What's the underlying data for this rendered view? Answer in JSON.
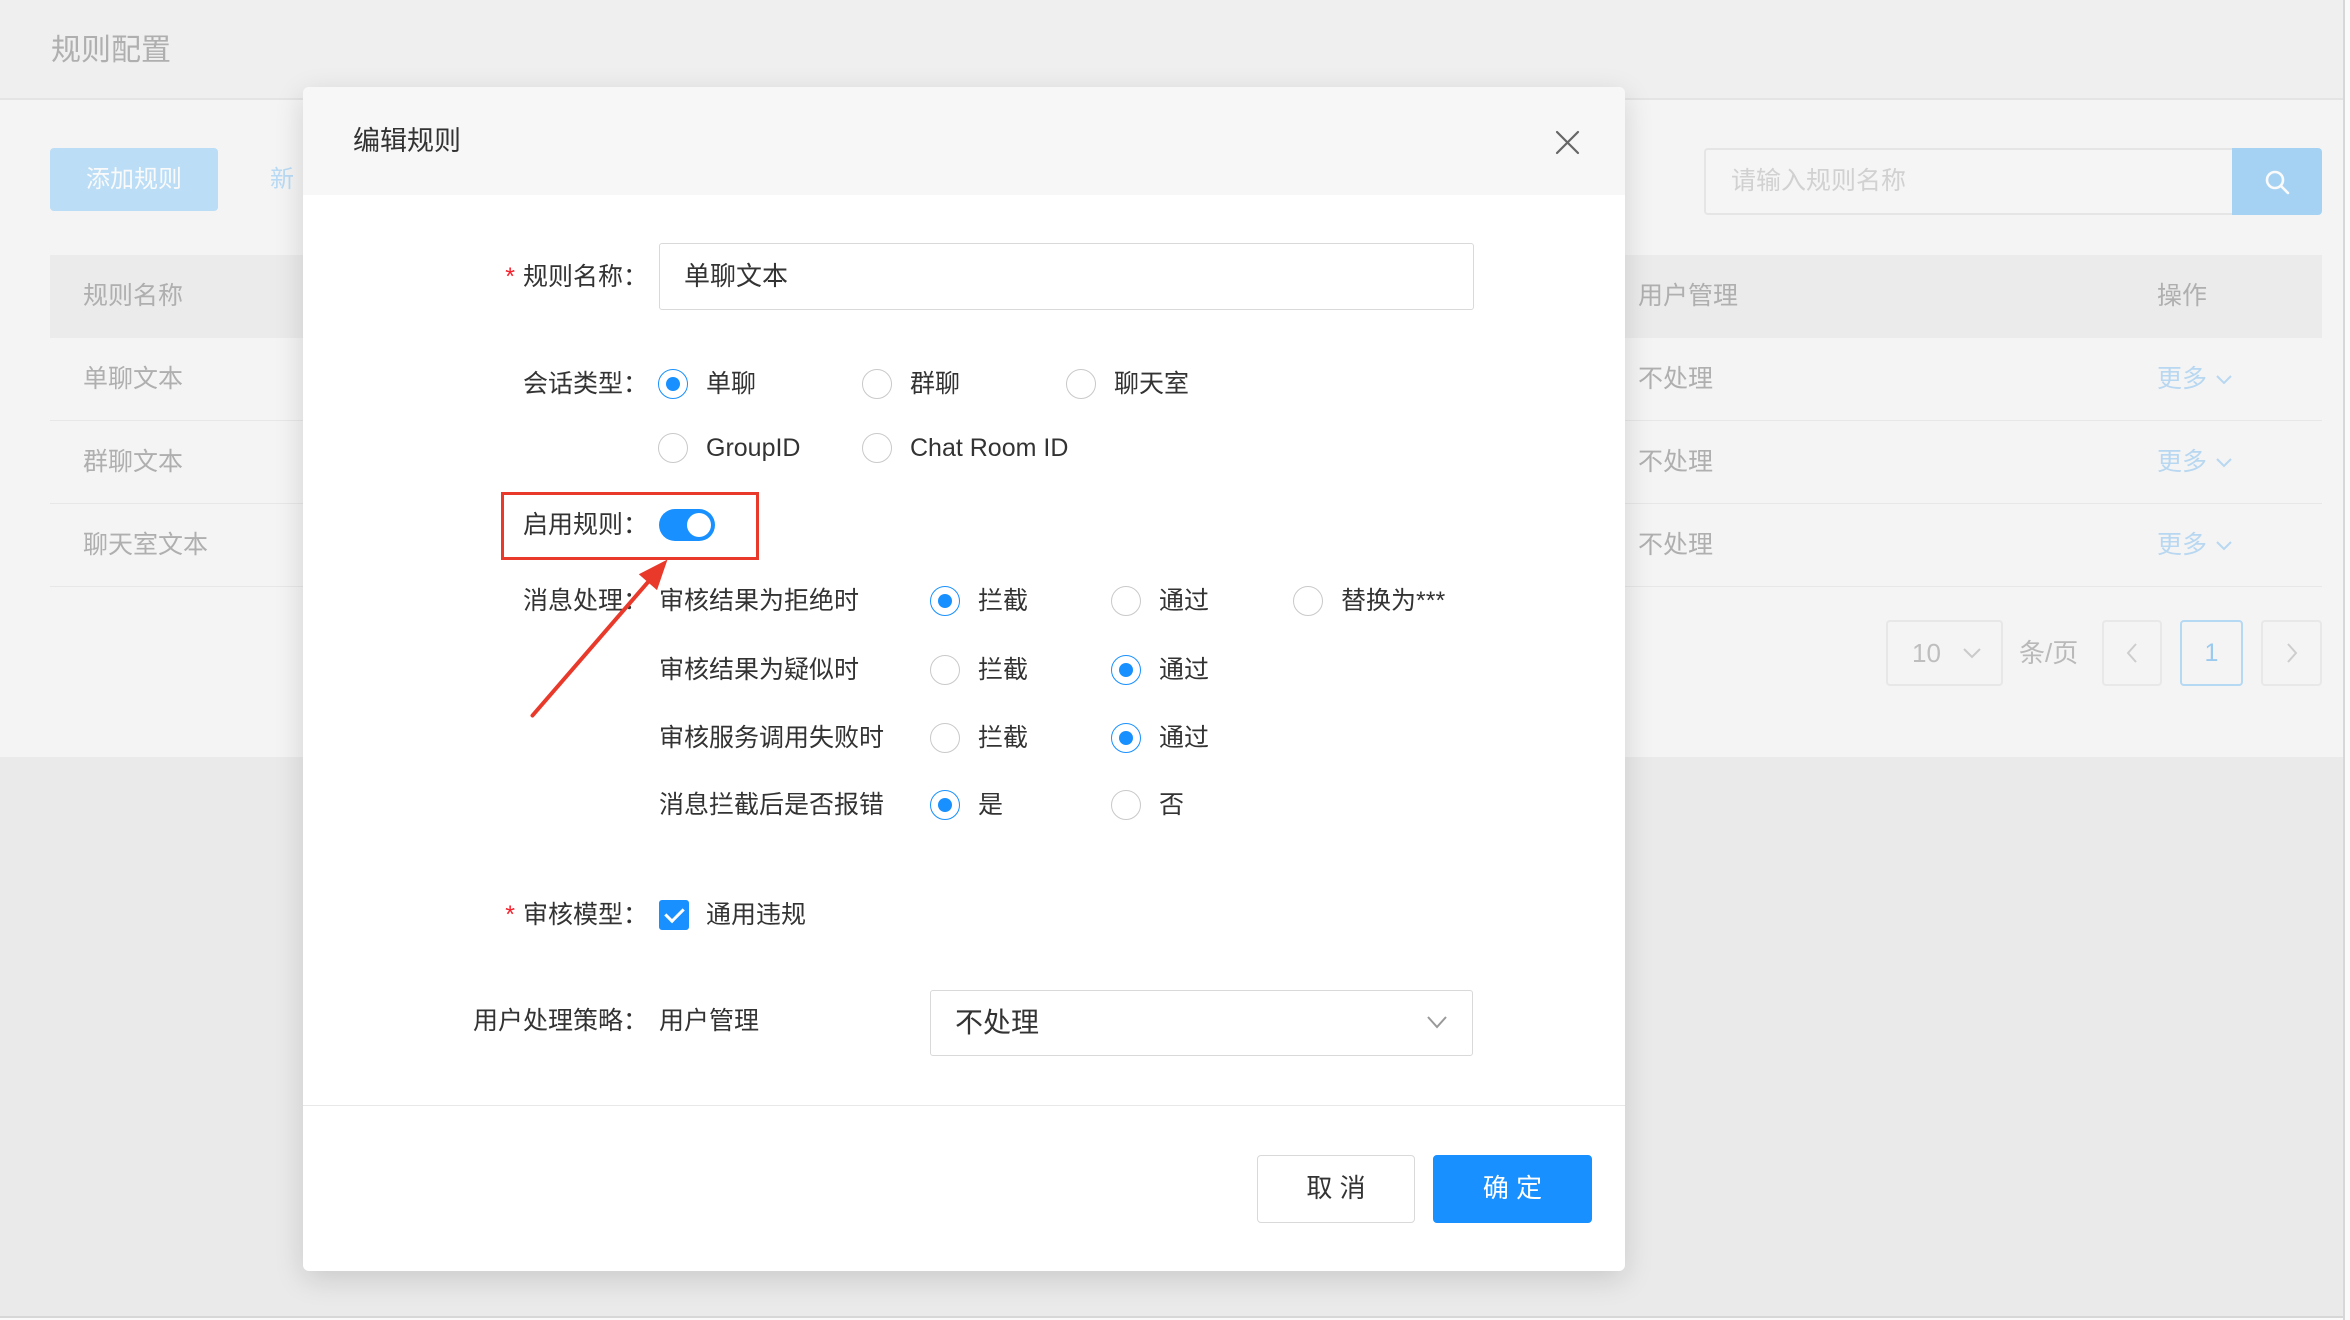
{
  "page": {
    "title": "规则配置"
  },
  "toolbar": {
    "add_rule_label": "添加规则",
    "secondary_link_label": "新",
    "search_placeholder": "请输入规则名称"
  },
  "table": {
    "columns": {
      "name": "规则名称",
      "user_management": "用户管理",
      "actions": "操作"
    },
    "rows": [
      {
        "name": "单聊文本",
        "user_management": "不处理",
        "action": "更多"
      },
      {
        "name": "群聊文本",
        "user_management": "不处理",
        "action": "更多"
      },
      {
        "name": "聊天室文本",
        "user_management": "不处理",
        "action": "更多"
      }
    ]
  },
  "pagination": {
    "page_size": "10",
    "page_size_unit": "条/页",
    "current_page": "1"
  },
  "modal": {
    "title": "编辑规则",
    "form": {
      "rule_name": {
        "required_mark": "*",
        "label": "规则名称：",
        "value": "单聊文本"
      },
      "session_type": {
        "label": "会话类型：",
        "options": [
          {
            "label": "单聊",
            "checked": true
          },
          {
            "label": "群聊",
            "checked": false
          },
          {
            "label": "聊天室",
            "checked": false
          },
          {
            "label": "GroupID",
            "checked": false
          },
          {
            "label": "Chat Room ID",
            "checked": false
          }
        ]
      },
      "enable_rule": {
        "label": "启用规则：",
        "enabled": true
      },
      "message_handling": {
        "label": "消息处理：",
        "rows": [
          {
            "label": "审核结果为拒绝时",
            "options": [
              {
                "label": "拦截",
                "checked": true
              },
              {
                "label": "通过",
                "checked": false
              },
              {
                "label": "替换为***",
                "checked": false
              }
            ]
          },
          {
            "label": "审核结果为疑似时",
            "options": [
              {
                "label": "拦截",
                "checked": false
              },
              {
                "label": "通过",
                "checked": true
              }
            ]
          },
          {
            "label": "审核服务调用失败时",
            "options": [
              {
                "label": "拦截",
                "checked": false
              },
              {
                "label": "通过",
                "checked": true
              }
            ]
          },
          {
            "label": "消息拦截后是否报错",
            "options": [
              {
                "label": "是",
                "checked": true
              },
              {
                "label": "否",
                "checked": false
              }
            ]
          }
        ]
      },
      "audit_model": {
        "required_mark": "*",
        "label": "审核模型：",
        "option": "通用违规",
        "checked": true
      },
      "user_policy": {
        "label": "用户处理策略：",
        "sub_label": "用户管理",
        "value": "不处理"
      }
    },
    "footer": {
      "cancel_label": "取 消",
      "confirm_label": "确 定"
    }
  },
  "icons": {
    "close": "close-icon",
    "search": "search-icon",
    "dropdown": "chevron-down-icon",
    "prev": "chevron-left-icon",
    "next": "chevron-right-icon"
  },
  "colors": {
    "primary": "#1890ff",
    "annotation": "#e8392b",
    "required": "#f5222d"
  }
}
